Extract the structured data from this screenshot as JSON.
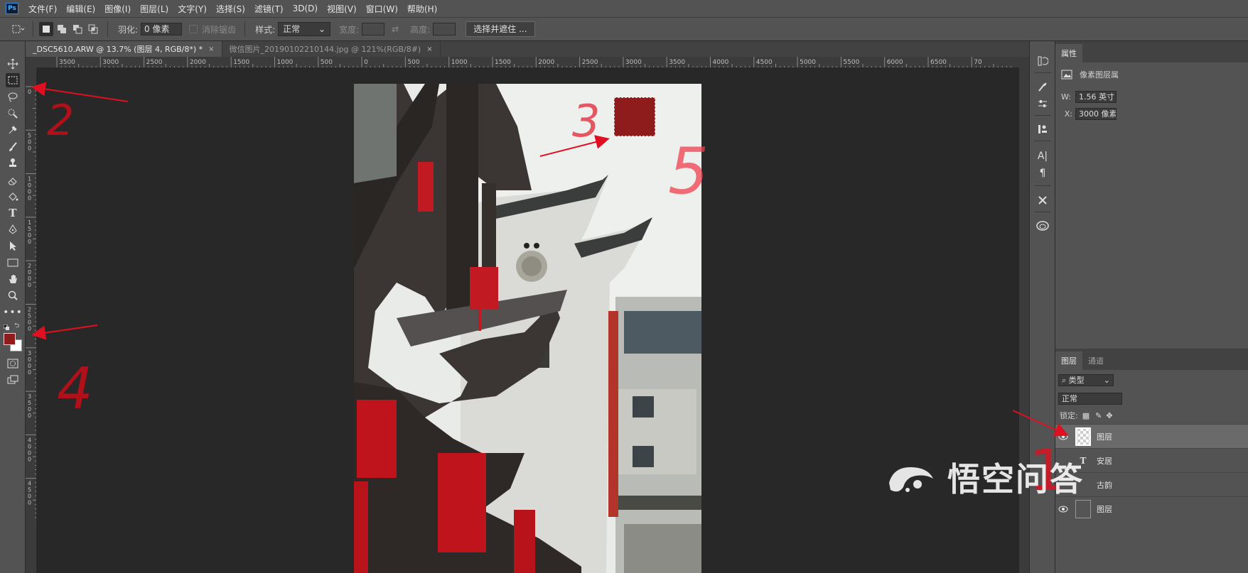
{
  "app": {
    "logo": "Ps"
  },
  "menu": [
    "文件(F)",
    "编辑(E)",
    "图像(I)",
    "图层(L)",
    "文字(Y)",
    "选择(S)",
    "滤镜(T)",
    "3D(D)",
    "视图(V)",
    "窗口(W)",
    "帮助(H)"
  ],
  "options": {
    "feather_label": "羽化:",
    "feather_value": "0 像素",
    "antialias_label": "消除锯齿",
    "style_label": "样式:",
    "style_value": "正常",
    "width_label": "宽度:",
    "height_label": "高度:",
    "select_mask_button": "选择并遮住 ..."
  },
  "tabs": [
    {
      "label": "_DSC5610.ARW @ 13.7% (图层 4, RGB/8*) *",
      "close": "×"
    },
    {
      "label": "微信图片_20190102210144.jpg @ 121%(RGB/8#)",
      "close": "×"
    }
  ],
  "hruler_labels": [
    "3500",
    "3000",
    "2500",
    "2000",
    "1500",
    "1000",
    "500",
    "0",
    "500",
    "1000",
    "1500",
    "2000",
    "2500",
    "3000",
    "3500",
    "4000",
    "4500",
    "5000",
    "5500",
    "6000",
    "6500",
    "70"
  ],
  "vruler_labels": [
    "0",
    "5\n0\n0",
    "1\n0\n0\n0",
    "1\n5\n0\n0",
    "2\n0\n0\n0",
    "2\n5\n0\n0",
    "3\n0\n0\n0",
    "3\n5\n0\n0",
    "4\n0\n0\n0",
    "4\n5\n0\n0"
  ],
  "properties": {
    "tab_label": "属性",
    "layer_type": "像素图层属",
    "w_label": "W:",
    "w_value": "1.56 英寸",
    "x_label": "X:",
    "x_value": "3000 像素"
  },
  "layers": {
    "tab_layers": "图层",
    "tab_channels": "通道",
    "filter_label": "类型",
    "blend_mode": "正常",
    "lock_label": "锁定:",
    "rows": [
      {
        "name": "图层"
      },
      {
        "name": "安居"
      },
      {
        "name": "古韵"
      },
      {
        "name": "图层"
      }
    ]
  },
  "annotations": {
    "n1": "1",
    "n2": "2",
    "n3": "3",
    "n4": "4",
    "n5": "5"
  },
  "colors": {
    "foreground": "#8e1c1d",
    "background": "#ffffff",
    "annotation_red": "#e01020"
  },
  "watermark": {
    "text": "悟空问答"
  }
}
